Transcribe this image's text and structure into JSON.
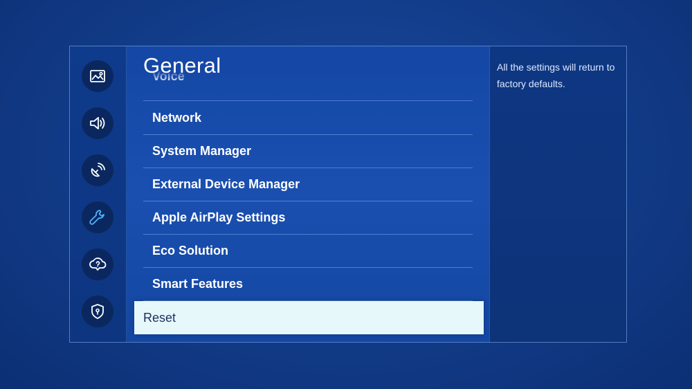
{
  "sidebar": {
    "icons": [
      {
        "name": "picture-icon",
        "active": false
      },
      {
        "name": "sound-icon",
        "active": false
      },
      {
        "name": "broadcasting-icon",
        "active": false
      },
      {
        "name": "general-wrench-icon",
        "active": true
      },
      {
        "name": "support-icon",
        "active": false
      },
      {
        "name": "privacy-shield-icon",
        "active": false
      }
    ]
  },
  "menu": {
    "title": "General",
    "items": [
      {
        "label": "Voice",
        "state": "partially-hidden"
      },
      {
        "label": "Network"
      },
      {
        "label": "System Manager"
      },
      {
        "label": "External Device Manager"
      },
      {
        "label": "Apple AirPlay Settings"
      },
      {
        "label": "Eco Solution"
      },
      {
        "label": "Smart Features"
      },
      {
        "label": "Reset",
        "selected": true
      }
    ]
  },
  "description": {
    "text": "All the settings will return to factory defaults."
  },
  "colors": {
    "accent": "#4fb3ff",
    "selected_bg": "#e7f8fb",
    "selected_text": "#1d2f5e"
  }
}
